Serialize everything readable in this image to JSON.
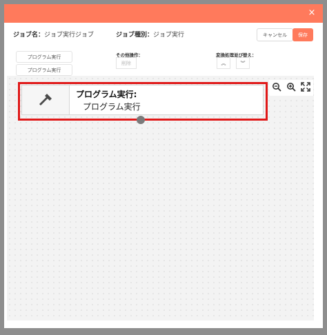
{
  "dialog": {
    "close_label": "×",
    "job_name_label": "ジョブ名：",
    "job_name_value": "ジョブ実行ジョブ",
    "job_type_label": "ジョブ種別：",
    "job_type_value": "ジョブ実行",
    "cancel_label": "キャンセル",
    "save_label": "保存"
  },
  "palette": {
    "items": [
      "プログラム実行",
      "プログラム実行"
    ]
  },
  "other_ops": {
    "label": "その他操作：",
    "delete_label": "削除"
  },
  "reorder": {
    "label": "変換処理並び替え：",
    "up_label": "︽",
    "down_label": "︾"
  },
  "node": {
    "title": "プログラム実行:",
    "subtitle": "プログラム実行",
    "icon": "hammer-icon"
  },
  "zoom": {
    "zoom_out_icon": "zoom-out-icon",
    "zoom_in_icon": "zoom-in-icon",
    "fit_icon": "fullscreen-icon"
  },
  "colors": {
    "accent": "#ff7a5c",
    "highlight": "#e01818"
  }
}
